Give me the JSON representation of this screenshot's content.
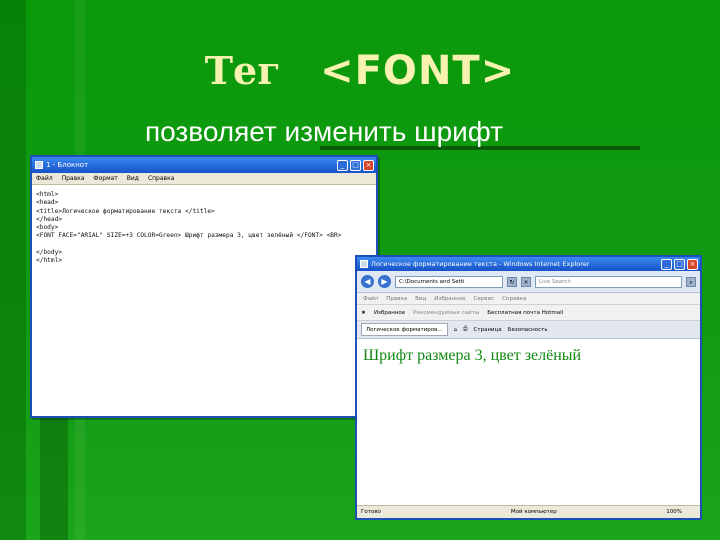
{
  "heading": {
    "tag_word": "Тег",
    "tag_code": "<FONT>",
    "subtitle": "позволяет изменить шрифт"
  },
  "notepad": {
    "title": "1 - Блокнот",
    "menu": [
      "Файл",
      "Правка",
      "Формат",
      "Вид",
      "Справка"
    ],
    "code": "<html>\n<head>\n<title>Логическое форматирование текста </title>\n</head>\n<body>\n<FONT FACE=\"ARIAL\" SIZE=+3 COLOR=Green> Шрифт размера 3, цвет зелёный </FONT> <BR>\n\n</body>\n</html>"
  },
  "ie": {
    "title": "Логическое форматирование текста - Windows Internet Explorer",
    "address": "C:\\Documents and Setti",
    "search_placeholder": "Live Search",
    "menu": [
      "Файл",
      "Правка",
      "Вид",
      "Избранное",
      "Сервис",
      "Справка"
    ],
    "favorites": "Избранное",
    "recommended": "Рекомендуемые сайты",
    "hotmail": "Бесплатная почта Hotmail",
    "tab_label": "Логическое форматиров...",
    "page_button": "Страница",
    "safety_button": "Безопасность",
    "page_text": "Шрифт размера 3, цвет зелёный",
    "status_done": "Готово",
    "status_zone": "Мой компьютер",
    "status_zoom": "100%"
  },
  "colors": {
    "background": "#109910",
    "title": "#f7f2b0",
    "page_text": "#118811"
  }
}
